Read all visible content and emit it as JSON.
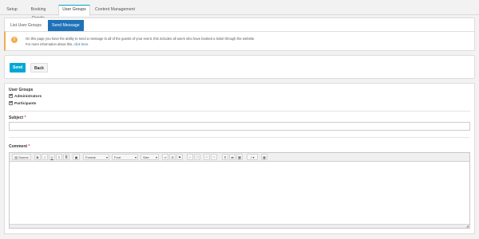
{
  "top_tabs": [
    {
      "label": "Setup"
    },
    {
      "label": "Booking Details"
    },
    {
      "label": "User Groups",
      "active": true
    },
    {
      "label": "Content Management"
    }
  ],
  "sub_tabs": [
    {
      "label": "List User Groups"
    },
    {
      "label": "Send Message",
      "active": true
    }
  ],
  "notice": {
    "icon": "info-icon",
    "line1": "On this page you have the ability to send a message to all of the guests of your event, this includes all users who have booked a ticket through the website.",
    "line2_prefix": "For more information about this, ",
    "line2_link": "click here."
  },
  "actions": {
    "send_label": "Send",
    "back_label": "Back"
  },
  "form": {
    "user_groups_label": "User Groups",
    "groups": [
      {
        "label": "Administrators",
        "checked": true
      },
      {
        "label": "Participants",
        "checked": true
      }
    ],
    "subject_label": "Subject",
    "subject_value": "",
    "comment_label": "Comment",
    "required_marker": "*"
  },
  "editor_toolbar": {
    "source_label": "Source",
    "bold": "B",
    "italic": "I",
    "underline": "U",
    "format_label": "Format",
    "font_label": "Font",
    "size_label": "Size"
  },
  "colors": {
    "accent_tab": "#00a6c7",
    "sub_tab_active": "#1f72b8",
    "send_button": "#00a9d3",
    "notice_border": "#f0ad4e",
    "required": "#e04040"
  }
}
